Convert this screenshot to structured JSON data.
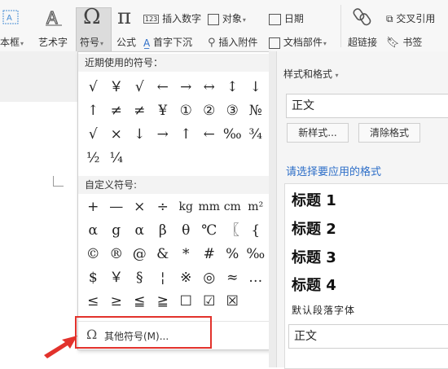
{
  "ribbon": {
    "textbox_label": "本框",
    "wordart_label": "艺术字",
    "symbol_label": "符号",
    "formula_label": "公式",
    "insert_number": "插入数字",
    "object": "对象",
    "date": "日期",
    "dropcap": "首字下沉",
    "insert_attachment": "插入附件",
    "doc_parts": "文档部件",
    "hyperlink": "超链接",
    "cross_ref": "交叉引用",
    "bookmark": "书签"
  },
  "symbol_menu": {
    "recent_title": "近期使用的符号：",
    "recent_symbols": [
      "√",
      "￥",
      "√",
      "←",
      "→",
      "↔",
      "↕",
      "↓",
      "↑",
      "≠",
      "≠",
      "¥",
      "①",
      "②",
      "③",
      "№",
      "√",
      "×",
      "↓",
      "→",
      "↑",
      "←",
      "‰",
      "¾",
      "½",
      "¼"
    ],
    "custom_title": "自定义符号:",
    "custom_symbols": [
      "+",
      "—",
      "×",
      "÷",
      "kg",
      "mm",
      "cm",
      "m²",
      "α",
      "g",
      "α",
      "β",
      "θ",
      "℃",
      "〖",
      "{",
      "©",
      "®",
      "@",
      "&",
      "*",
      "#",
      "%",
      "‰",
      "$",
      "￥",
      "§",
      "¦",
      "※",
      "◎",
      "≈",
      "…",
      "≤",
      "≥",
      "≦",
      "≧",
      "☐",
      "☑",
      "☒"
    ],
    "more_label": "其他符号(M)..."
  },
  "panel": {
    "title": "样式和格式",
    "current_style": "正文",
    "new_style_button": "新样式...",
    "clear_format_button": "清除格式",
    "apply_prompt": "请选择要应用的格式",
    "styles": [
      "标题  1",
      "标题  2",
      "标题  3",
      "标题  4"
    ],
    "default_font": "默认段落字体",
    "normal_style": "正文"
  },
  "colors": {
    "accent": "#2d6ec8",
    "highlight": "#e2322c"
  }
}
